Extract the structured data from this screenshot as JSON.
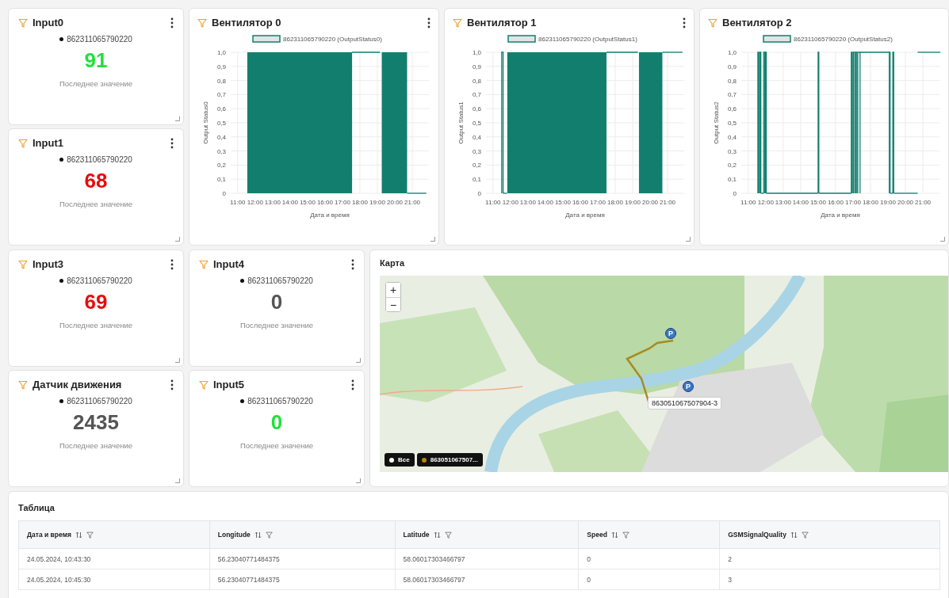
{
  "top_cards": [
    {
      "title": "Input0",
      "device": "862311065790220",
      "value": "91",
      "color": "#22e03c",
      "caption": "Последнее значение"
    },
    {
      "title": "Input1",
      "device": "862311065790220",
      "value": "68",
      "color": "#e80c0c",
      "caption": "Последнее значение"
    }
  ],
  "charts": [
    {
      "title": "Вентилятор 0",
      "menu": true,
      "legend": "862311065790220 (OutputStatus0)",
      "ylabel": "Output Status0",
      "xlabel": "Дата и время",
      "yticks": [
        "1,0",
        "0,9",
        "0,8",
        "0,7",
        "0,6",
        "0,5",
        "0,4",
        "0,3",
        "0,2",
        "0,1",
        "0"
      ],
      "xticks": [
        "11:00",
        "12:00",
        "13:00",
        "14:00",
        "15:00",
        "16:00",
        "17:00",
        "18:00",
        "19:00",
        "20:00",
        "21:00"
      ]
    },
    {
      "title": "Вентилятор 1",
      "menu": true,
      "legend": "862311065790220 (OutputStatus1)",
      "ylabel": "Output Status1",
      "xlabel": "Дата и время",
      "yticks": [
        "1,0",
        "0,9",
        "0,8",
        "0,7",
        "0,6",
        "0,5",
        "0,4",
        "0,3",
        "0,2",
        "0,1",
        "0"
      ],
      "xticks": [
        "11:00",
        "12:00",
        "13:00",
        "14:00",
        "15:00",
        "16:00",
        "17:00",
        "18:00",
        "19:00",
        "20:00",
        "21:00"
      ]
    },
    {
      "title": "Вентилятор 2",
      "menu": false,
      "legend": "862311065790220 (OutputStatus2)",
      "ylabel": "Output Status2",
      "xlabel": "Дата и время",
      "yticks": [
        "1,0",
        "0,9",
        "0,8",
        "0,7",
        "0,6",
        "0,5",
        "0,4",
        "0,3",
        "0,2",
        "0,1",
        "0"
      ],
      "xticks": [
        "11:00",
        "12:00",
        "13:00",
        "14:00",
        "15:00",
        "16:00",
        "17:00",
        "18:00",
        "19:00",
        "20:00",
        "21:00"
      ]
    }
  ],
  "bottom_cards": [
    {
      "title": "Input3",
      "device": "862311065790220",
      "value": "69",
      "color": "#e80c0c",
      "caption": "Последнее значение"
    },
    {
      "title": "Input4",
      "device": "862311065790220",
      "value": "0",
      "color": "#555555",
      "caption": "Последнее значение"
    },
    {
      "title": "Датчик движения",
      "device": "862311065790220",
      "value": "2435",
      "color": "#555555",
      "caption": "Последнее значение"
    },
    {
      "title": "Input5",
      "device": "862311065790220",
      "value": "0",
      "color": "#22e03c",
      "caption": "Последнее значение"
    }
  ],
  "map": {
    "title": "Карта",
    "zoom_in": "+",
    "zoom_out": "−",
    "parking_markers": [
      "P",
      "P"
    ],
    "marker_label": "863051067507904-3",
    "filters": [
      {
        "label": "Все",
        "color": "#ffffff"
      },
      {
        "label": "863051067507...",
        "color": "#b8860b"
      }
    ]
  },
  "table": {
    "title": "Таблица",
    "columns": [
      "Дата и время",
      "Longitude",
      "Latitude",
      "Speed",
      "GSMSignalQuality"
    ],
    "rows": [
      [
        "24.05.2024, 10:43:30",
        "56.23040771484375",
        "58.06017303466797",
        "0",
        "2"
      ],
      [
        "24.05.2024, 10:45:30",
        "56.23040771484375",
        "58.06017303466797",
        "0",
        "3"
      ]
    ]
  }
}
